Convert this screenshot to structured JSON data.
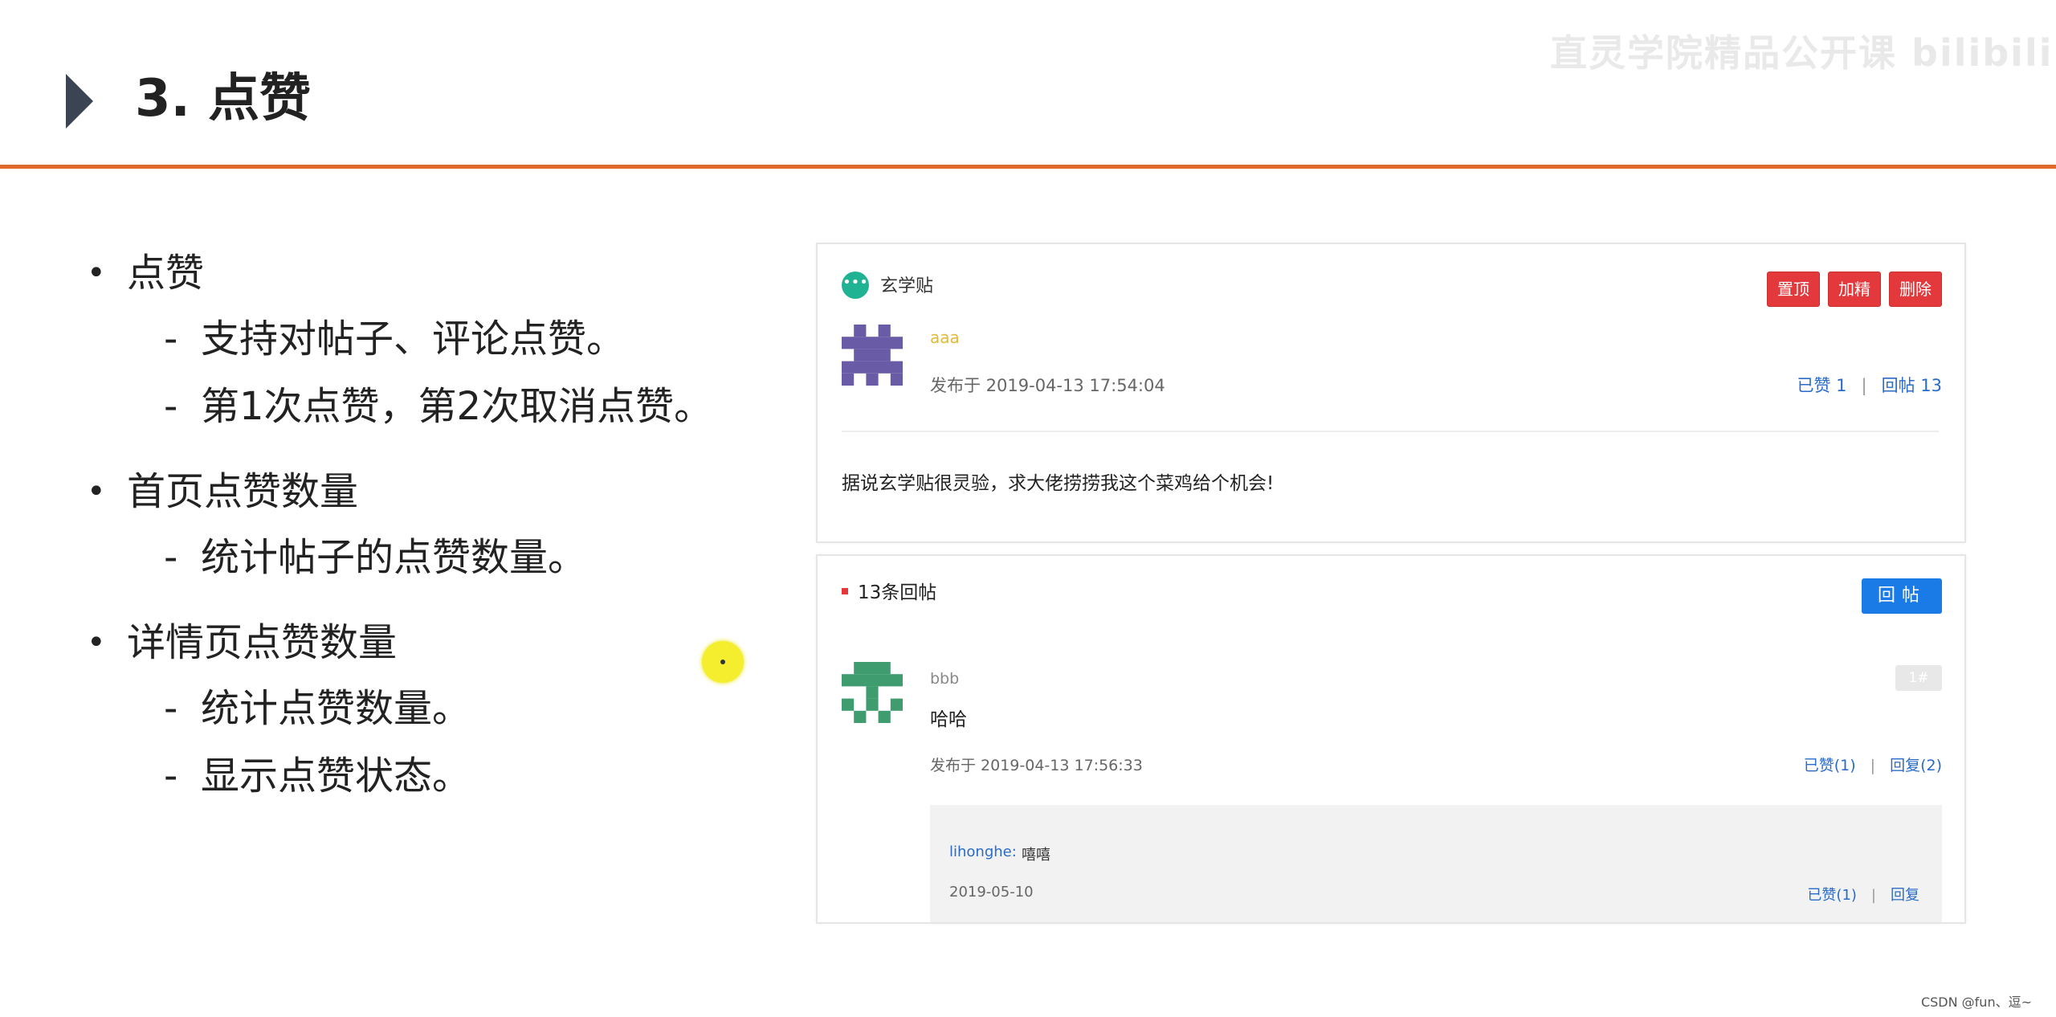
{
  "slide": {
    "title": "3. 点赞",
    "watermark": "直灵学院精品公开课 bilibili"
  },
  "bullets": [
    {
      "text": "点赞",
      "subs": [
        "支持对帖子、评论点赞。",
        "第1次点赞，第2次取消点赞。"
      ]
    },
    {
      "text": "首页点赞数量",
      "subs": [
        "统计帖子的点赞数量。"
      ]
    },
    {
      "text": "详情页点赞数量",
      "subs": [
        "统计点赞数量。",
        "显示点赞状态。"
      ]
    }
  ],
  "post": {
    "type_label": "玄学贴",
    "buttons": [
      "置顶",
      "加精",
      "删除"
    ],
    "author": "aaa",
    "time": "发布于 2019-04-13 17:54:04",
    "likes": "已赞 1",
    "replies": "回帖 13",
    "body": "据说玄学贴很灵验，求大佬捞捞我这个菜鸡给个机会!"
  },
  "reply_section": {
    "count_label": "13条回帖",
    "reply_button": "回帖",
    "reply": {
      "user": "bbb",
      "floor": "1#",
      "text": "哈哈",
      "time": "发布于 2019-04-13 17:56:33",
      "likes": "已赞(1)",
      "replies": "回复(2)",
      "sub": {
        "user": "lihonghe:",
        "text": "嘻嘻",
        "time": "2019-05-10",
        "likes": "已赞(1)",
        "reply": "回复"
      }
    }
  },
  "footer_watermark": "CSDN @fun、逗~",
  "colors": {
    "accent": "#e06a2b",
    "danger": "#e4393c",
    "primary": "#1a7ae6",
    "link": "#2a6bc7"
  }
}
